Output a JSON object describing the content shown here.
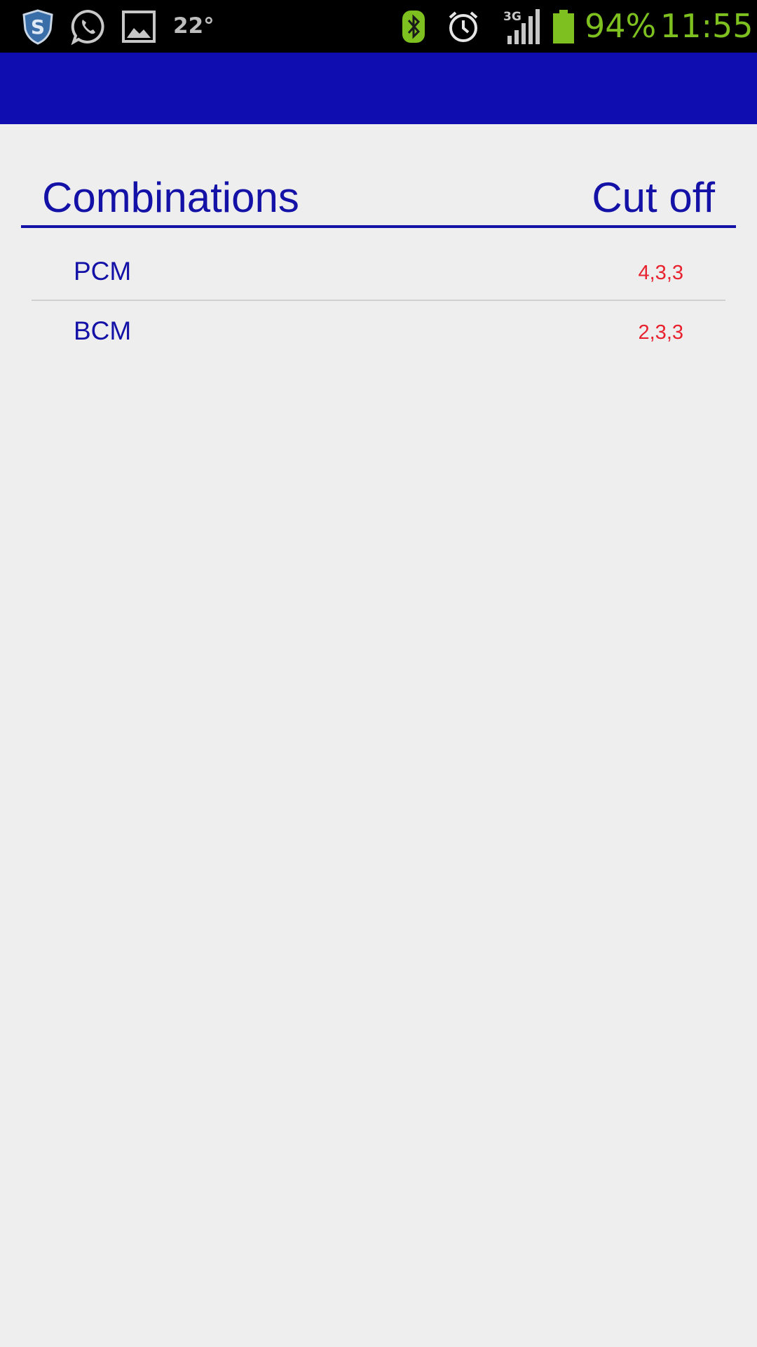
{
  "status_bar": {
    "icons": [
      "shield-icon",
      "whatsapp-icon",
      "gallery-icon",
      "bluetooth-icon",
      "alarm-icon",
      "signal-icon",
      "battery-icon"
    ],
    "temperature": "22°",
    "network_type": "3G",
    "battery": "94%",
    "time": "11:55",
    "colors": {
      "background": "#000000",
      "accent_green": "#7dc01f",
      "icon_gray": "#bdbdbd"
    }
  },
  "action_bar": {
    "color": "#0f0db0"
  },
  "table": {
    "header": {
      "left": "Combinations",
      "right": "Cut off",
      "color": "#1411a7"
    },
    "rows": [
      {
        "name": "PCM",
        "cutoff": "4,3,3"
      },
      {
        "name": "BCM",
        "cutoff": "2,3,3"
      }
    ],
    "value_color": "#e8232f"
  }
}
